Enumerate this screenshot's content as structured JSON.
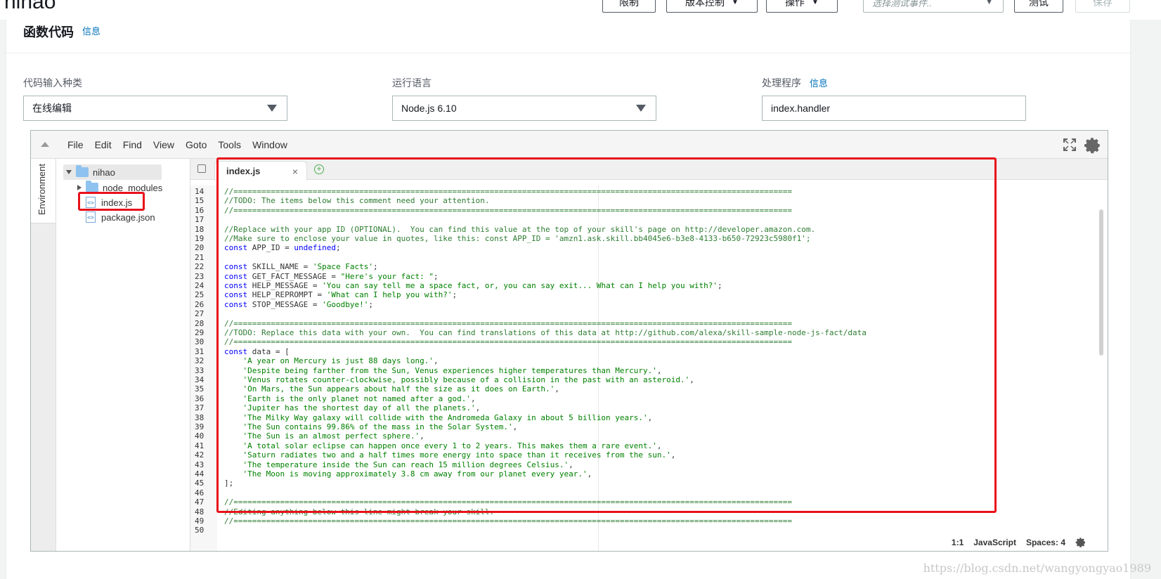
{
  "header": {
    "function_name": "nihao",
    "buttons": [
      {
        "label": "限制",
        "caret": false
      },
      {
        "label": "版本控制",
        "caret": true
      },
      {
        "label": "操作",
        "caret": true
      }
    ],
    "test_event_placeholder": "选择测试事件..",
    "test_label": "测试",
    "save_label": "保存"
  },
  "panel": {
    "title": "函数代码",
    "info": "信息",
    "fields": {
      "code_entry": {
        "label": "代码输入种类",
        "value": "在线编辑"
      },
      "runtime": {
        "label": "运行语言",
        "value": "Node.js 6.10"
      },
      "handler": {
        "label": "处理程序",
        "info": "信息",
        "value": "index.handler"
      }
    }
  },
  "ide": {
    "menu": [
      "File",
      "Edit",
      "Find",
      "View",
      "Goto",
      "Tools",
      "Window"
    ],
    "environment_tab": "Environment",
    "tree": {
      "root": "nihao",
      "items": [
        "node_modules",
        "index.js",
        "package.json"
      ]
    },
    "tab_name": "index.js",
    "tab_close": "×",
    "status": {
      "position": "1:1",
      "language": "JavaScript",
      "spaces": "Spaces: 4"
    }
  },
  "code": [
    {
      "n": "14",
      "parts": [
        [
          "cm",
          "//========================================================================================================================"
        ]
      ]
    },
    {
      "n": "15",
      "parts": [
        [
          "cm",
          "//TODO: The items below this comment need your attention."
        ]
      ]
    },
    {
      "n": "16",
      "parts": [
        [
          "cm",
          "//========================================================================================================================"
        ]
      ]
    },
    {
      "n": "17",
      "parts": []
    },
    {
      "n": "18",
      "parts": [
        [
          "cm",
          "//Replace with your app ID (OPTIONAL).  You can find this value at the top of your skill's page on http://developer.amazon.com."
        ]
      ]
    },
    {
      "n": "19",
      "parts": [
        [
          "cm",
          "//Make sure to enclose your value in quotes, like this: const APP_ID = 'amzn1.ask.skill.bb4045e6-b3e8-4133-b650-72923c5980f1';"
        ]
      ]
    },
    {
      "n": "20",
      "parts": [
        [
          "kw",
          "const"
        ],
        [
          "",
          " APP_ID = "
        ],
        [
          "kw",
          "undefined"
        ],
        [
          "",
          ";"
        ]
      ]
    },
    {
      "n": "21",
      "parts": []
    },
    {
      "n": "22",
      "parts": [
        [
          "kw",
          "const"
        ],
        [
          "",
          " SKILL_NAME = "
        ],
        [
          "str2",
          "'Space Facts'"
        ],
        [
          "",
          ";"
        ]
      ]
    },
    {
      "n": "23",
      "parts": [
        [
          "kw",
          "const"
        ],
        [
          "",
          " GET_FACT_MESSAGE = "
        ],
        [
          "str2",
          "\"Here's your fact: \""
        ],
        [
          "",
          ";"
        ]
      ]
    },
    {
      "n": "24",
      "parts": [
        [
          "kw",
          "const"
        ],
        [
          "",
          " HELP_MESSAGE = "
        ],
        [
          "str2",
          "'You can say tell me a space fact, or, you can say exit... What can I help you with?'"
        ],
        [
          "",
          ";"
        ]
      ]
    },
    {
      "n": "25",
      "parts": [
        [
          "kw",
          "const"
        ],
        [
          "",
          " HELP_REPROMPT = "
        ],
        [
          "str2",
          "'What can I help you with?'"
        ],
        [
          "",
          ";"
        ]
      ]
    },
    {
      "n": "26",
      "parts": [
        [
          "kw",
          "const"
        ],
        [
          "",
          " STOP_MESSAGE = "
        ],
        [
          "str2",
          "'Goodbye!'"
        ],
        [
          "",
          ";"
        ]
      ]
    },
    {
      "n": "27",
      "parts": []
    },
    {
      "n": "28",
      "parts": [
        [
          "cm",
          "//========================================================================================================================"
        ]
      ]
    },
    {
      "n": "29",
      "parts": [
        [
          "cm",
          "//TODO: Replace this data with your own.  You can find translations of this data at http://github.com/alexa/skill-sample-node-js-fact/data"
        ]
      ]
    },
    {
      "n": "30",
      "parts": [
        [
          "cm",
          "//========================================================================================================================"
        ]
      ]
    },
    {
      "n": "31",
      "parts": [
        [
          "kw",
          "const"
        ],
        [
          "",
          " data = ["
        ]
      ]
    },
    {
      "n": "32",
      "parts": [
        [
          "",
          "    "
        ],
        [
          "str2",
          "'A year on Mercury is just 88 days long.'"
        ],
        [
          "",
          ","
        ]
      ]
    },
    {
      "n": "33",
      "parts": [
        [
          "",
          "    "
        ],
        [
          "str2",
          "'Despite being farther from the Sun, Venus experiences higher temperatures than Mercury.'"
        ],
        [
          "",
          ","
        ]
      ]
    },
    {
      "n": "34",
      "parts": [
        [
          "",
          "    "
        ],
        [
          "str2",
          "'Venus rotates counter-clockwise, possibly because of a collision in the past with an asteroid.'"
        ],
        [
          "",
          ","
        ]
      ]
    },
    {
      "n": "35",
      "parts": [
        [
          "",
          "    "
        ],
        [
          "str2",
          "'On Mars, the Sun appears about half the size as it does on Earth.'"
        ],
        [
          "",
          ","
        ]
      ]
    },
    {
      "n": "36",
      "parts": [
        [
          "",
          "    "
        ],
        [
          "str2",
          "'Earth is the only planet not named after a god.'"
        ],
        [
          "",
          ","
        ]
      ]
    },
    {
      "n": "37",
      "parts": [
        [
          "",
          "    "
        ],
        [
          "str2",
          "'Jupiter has the shortest day of all the planets.'"
        ],
        [
          "",
          ","
        ]
      ]
    },
    {
      "n": "38",
      "parts": [
        [
          "",
          "    "
        ],
        [
          "str2",
          "'The Milky Way galaxy will collide with the Andromeda Galaxy in about 5 billion years.'"
        ],
        [
          "",
          ","
        ]
      ]
    },
    {
      "n": "39",
      "parts": [
        [
          "",
          "    "
        ],
        [
          "str2",
          "'The Sun contains 99.86% of the mass in the Solar System.'"
        ],
        [
          "",
          ","
        ]
      ]
    },
    {
      "n": "40",
      "parts": [
        [
          "",
          "    "
        ],
        [
          "str2",
          "'The Sun is an almost perfect sphere.'"
        ],
        [
          "",
          ","
        ]
      ]
    },
    {
      "n": "41",
      "parts": [
        [
          "",
          "    "
        ],
        [
          "str2",
          "'A total solar eclipse can happen once every 1 to 2 years. This makes them a rare event.'"
        ],
        [
          "",
          ","
        ]
      ]
    },
    {
      "n": "42",
      "parts": [
        [
          "",
          "    "
        ],
        [
          "str2",
          "'Saturn radiates two and a half times more energy into space than it receives from the sun.'"
        ],
        [
          "",
          ","
        ]
      ]
    },
    {
      "n": "43",
      "parts": [
        [
          "",
          "    "
        ],
        [
          "str2",
          "'The temperature inside the Sun can reach 15 million degrees Celsius.'"
        ],
        [
          "",
          ","
        ]
      ]
    },
    {
      "n": "44",
      "parts": [
        [
          "",
          "    "
        ],
        [
          "str2",
          "'The Moon is moving approximately 3.8 cm away from our planet every year.'"
        ],
        [
          "",
          ","
        ]
      ]
    },
    {
      "n": "45",
      "parts": [
        [
          "",
          "];"
        ]
      ]
    },
    {
      "n": "46",
      "parts": []
    },
    {
      "n": "47",
      "parts": [
        [
          "cm",
          "//========================================================================================================================"
        ]
      ]
    },
    {
      "n": "48",
      "parts": [
        [
          "cm",
          "//Editing anything below this line might break your skill."
        ]
      ]
    },
    {
      "n": "49",
      "parts": [
        [
          "cm",
          "//========================================================================================================================"
        ]
      ]
    },
    {
      "n": "50",
      "parts": []
    }
  ],
  "watermark": "https://blog.csdn.net/wangyongyao1989"
}
